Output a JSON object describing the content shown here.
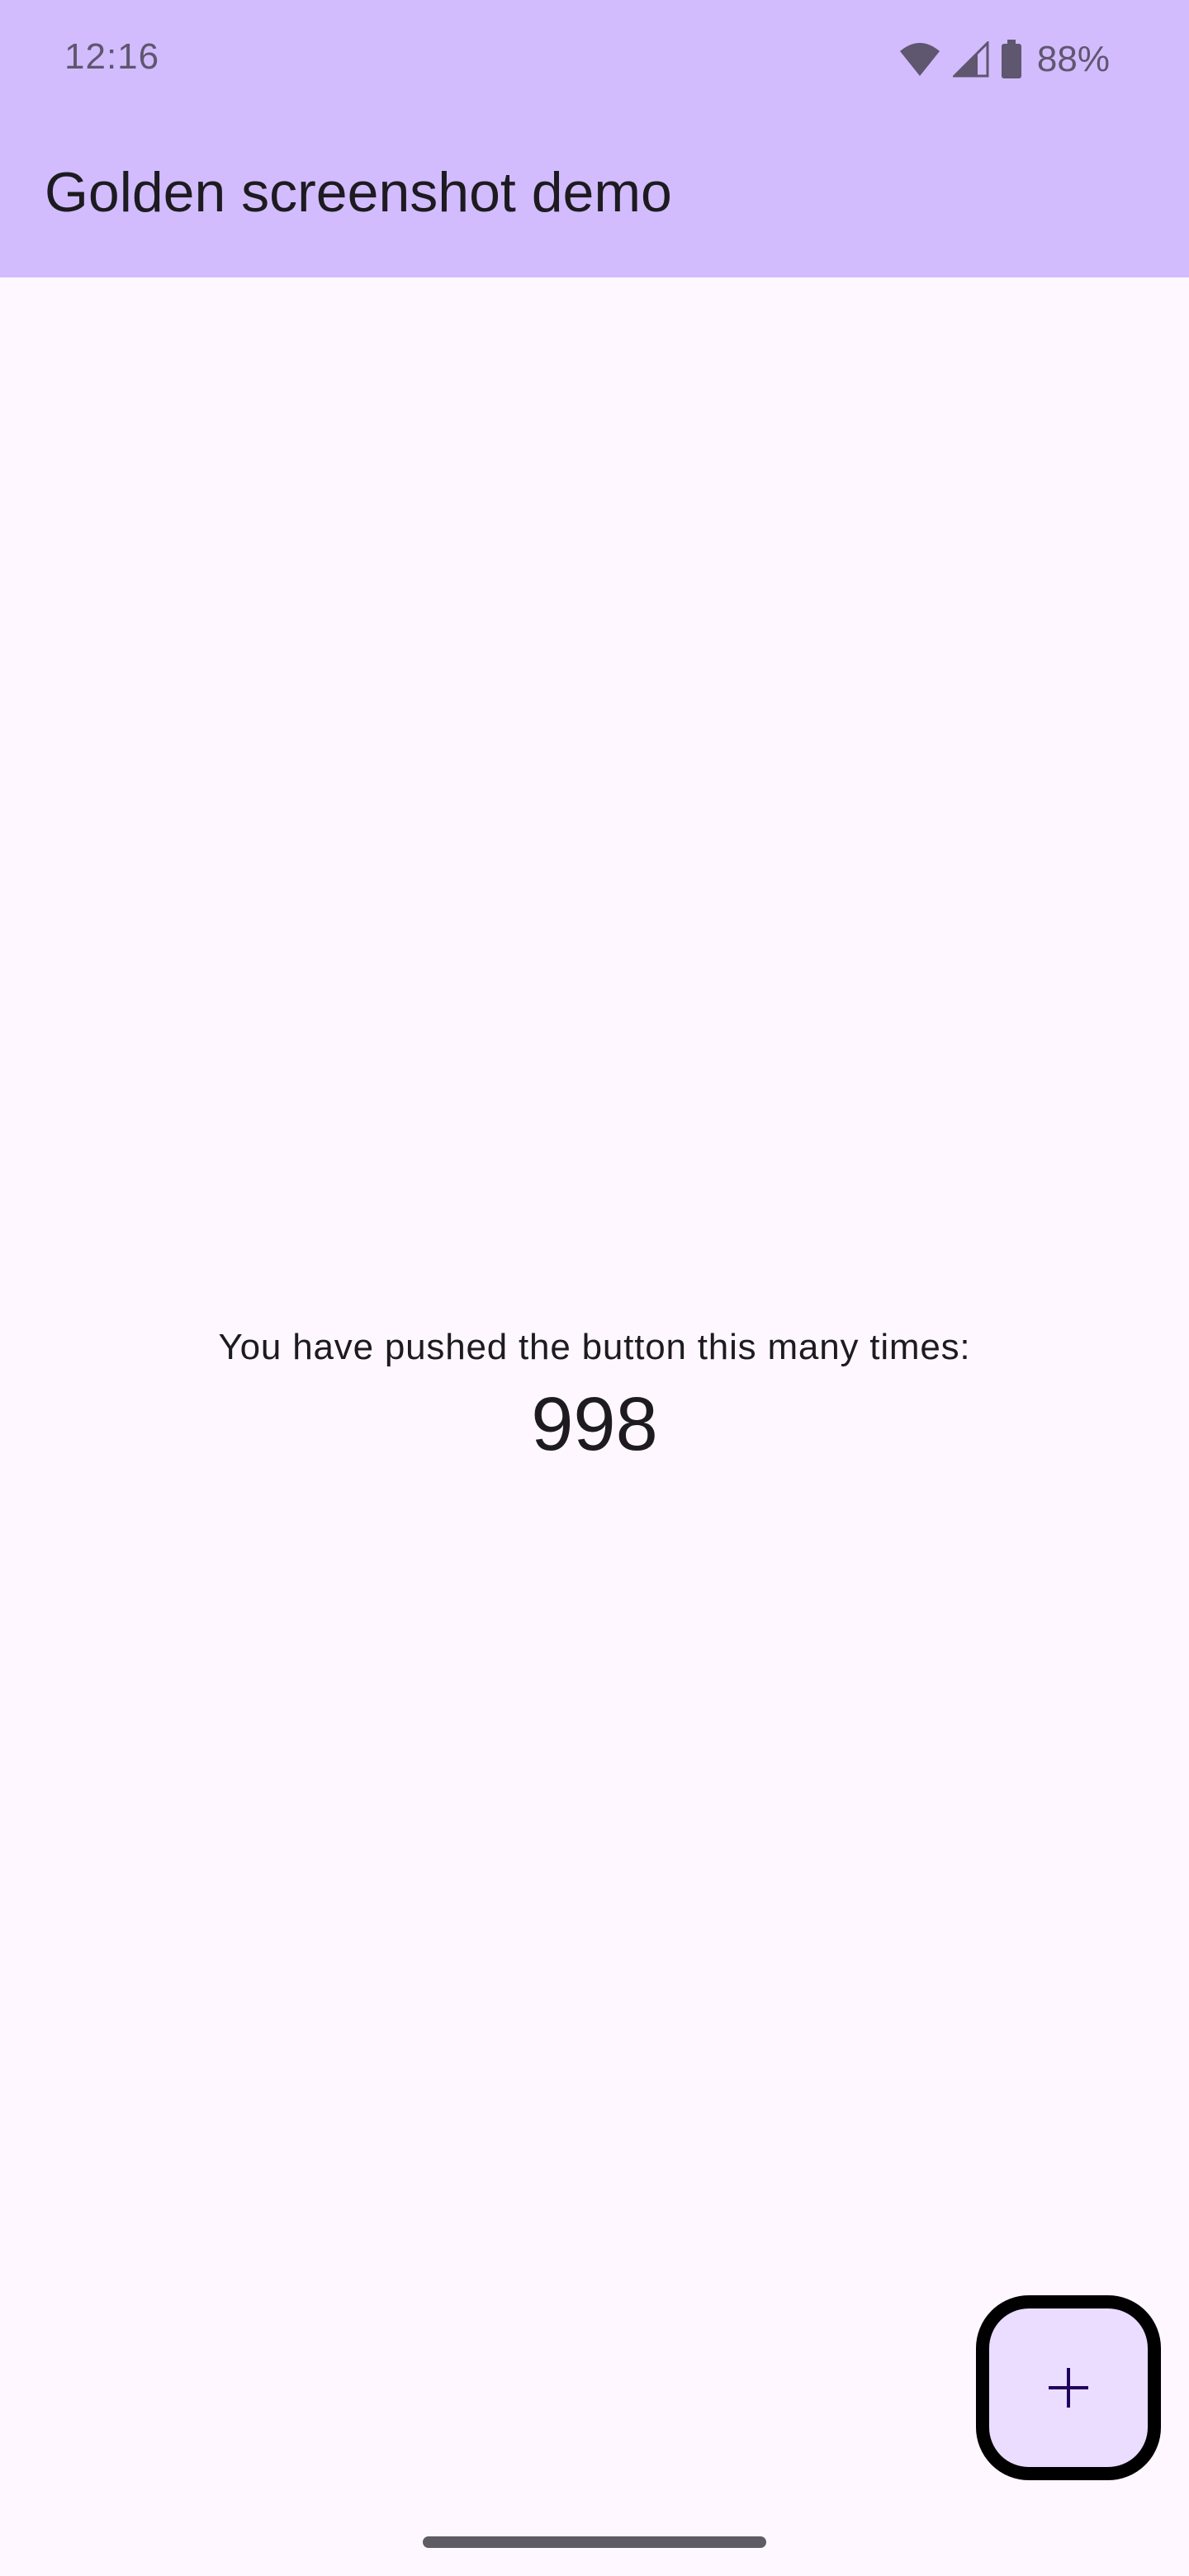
{
  "status_bar": {
    "time": "12:16",
    "battery_percent": "88%",
    "icons": [
      "wifi-icon",
      "cell-signal-icon",
      "battery-icon"
    ]
  },
  "app_bar": {
    "title": "Golden screenshot demo",
    "background_color": "#D2BCFD"
  },
  "counter": {
    "label": "You have pushed the button this many times:",
    "value": "998"
  },
  "fab": {
    "icon": "add-icon",
    "background_color": "#EADDFF",
    "border_color": "#000000"
  },
  "colors": {
    "page_background": "#FEF7FF",
    "text_primary": "#1D1B20"
  }
}
